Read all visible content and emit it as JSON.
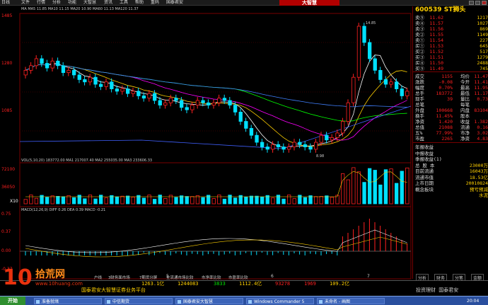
{
  "titlebar": {
    "left_label": "日线",
    "menus": [
      "文件",
      "行情",
      "分析",
      "功能",
      "大智慧",
      "资讯",
      "工具",
      "帮助",
      "重码",
      "国泰君安"
    ],
    "brand": "大智慧"
  },
  "indicator_line": "MA MA5 11.85  MA10 11.15  MA20 10.90  MA60 11.13  MA120 11.37",
  "chart": {
    "price_labels": [
      "1485",
      "1280",
      "1085"
    ],
    "price_low_label": "8.98",
    "price_high_label": "14.85",
    "vol_header": "VOL(5,10,20)  183772.00  MA1 217007.40  MA2 255035.00  MA3 233606.33",
    "vol_labels": [
      "72100",
      "36050",
      "X10"
    ],
    "macd_header": "MACD(12,26,9)  DIFF 0.26  DEA 0.39  MACD -0.21",
    "macd_labels": [
      "0.75",
      "0.37",
      "0.00",
      "-0.37"
    ],
    "x_ticks": [
      "5",
      "6",
      "7"
    ],
    "bottom_tabs": [
      "分时",
      "日线",
      "周线",
      "月线",
      "K线"
    ]
  },
  "right_panel": {
    "title": "600539 ST狮头",
    "order_book": [
      {
        "label": "卖⑤",
        "price": "11.62",
        "vol": "1217"
      },
      {
        "label": "卖④",
        "price": "11.57",
        "vol": "1027"
      },
      {
        "label": "卖③",
        "price": "11.56",
        "vol": "869"
      },
      {
        "label": "卖②",
        "price": "11.55",
        "vol": "1149"
      },
      {
        "label": "卖①",
        "price": "11.54",
        "vol": "227"
      },
      {
        "label": "买①",
        "price": "11.53",
        "vol": "645"
      },
      {
        "label": "买②",
        "price": "11.52",
        "vol": "517"
      },
      {
        "label": "买③",
        "price": "11.51",
        "vol": "1279"
      },
      {
        "label": "买④",
        "price": "11.50",
        "vol": "2488"
      },
      {
        "label": "买⑤",
        "price": "11.49",
        "vol": "745"
      }
    ],
    "stats": [
      {
        "k": "成交",
        "v": "1155",
        "k2": "均价",
        "v2": "11.47"
      },
      {
        "k": "涨跌",
        "v": "-0.08",
        "k2": "今开",
        "v2": "11.41"
      },
      {
        "k": "幅度",
        "v": "0.70%",
        "k2": "最高",
        "v2": "11.95"
      },
      {
        "k": "总手",
        "v": "183772",
        "k2": "最低",
        "v2": "11.17"
      },
      {
        "k": "现手",
        "v": "39",
        "k2": "量比",
        "v2": "0.73"
      },
      {
        "k": "总笔",
        "v": "",
        "k2": "每笔",
        "v2": ""
      },
      {
        "k": "外盘",
        "v": "100668",
        "k2": "内盘",
        "v2": "83104"
      },
      {
        "k": "换手",
        "v": "11.45%",
        "k2": "股本",
        "v2": ""
      },
      {
        "k": "净资",
        "v": "1.420",
        "k2": "收益",
        "v2": "1.382"
      },
      {
        "k": "总值",
        "v": "21088",
        "k2": "流通",
        "v2": "0.16"
      },
      {
        "k": "五%",
        "v": "77.99%",
        "k2": "市净",
        "v2": "3.02"
      },
      {
        "k": "市盈",
        "v": "2265",
        "k2": "净资",
        "v2": "4.83"
      }
    ],
    "finance": [
      {
        "k": "年报收益",
        "v": ""
      },
      {
        "k": "中报收益",
        "v": ""
      },
      {
        "k": "季报收益(1)",
        "v": ""
      },
      {
        "k": "总 股 本",
        "v": "23000万"
      },
      {
        "k": "目前流通",
        "v": "16043万"
      },
      {
        "k": "流通市值",
        "v": "18.53亿"
      },
      {
        "k": "上市日期",
        "v": "20010824"
      },
      {
        "k": "概念板块",
        "v": "预亏预减"
      },
      {
        "k": "",
        "v": "水泥"
      }
    ],
    "footer_tabs": [
      "分析",
      "财务",
      "分笔",
      "金额"
    ]
  },
  "statusbar": {
    "line1": [
      "1263.1亿",
      "1244083",
      "3833",
      "1112.4亿",
      "93278",
      "1969",
      "109.2亿"
    ],
    "line1b": "投资理财 国泰君安",
    "line2": "国泰君安大智慧证券业务平台",
    "tabs_row": [
      "户线",
      "3财务面市场",
      "7期货分屏",
      "全流通市场比较",
      "市净率比较",
      "市盈率比较"
    ]
  },
  "logo": {
    "num": "10",
    "cn": "拾荒网",
    "url": "www.10huang.com"
  },
  "taskbar": {
    "start": "开始",
    "items": [
      "准备就绪",
      "中信期货",
      "国泰君安大智慧",
      "Windows Commander 5",
      "未命名 - 画图"
    ],
    "clock": "20:04"
  },
  "colors": {
    "up": "#ff2020",
    "down": "#00e0ff",
    "ma5": "#ffffff",
    "ma10": "#ffd000",
    "ma20": "#ff00ff",
    "ma60": "#00ff00",
    "ma120": "#4080ff",
    "ma250": "#a0a0a0"
  }
}
